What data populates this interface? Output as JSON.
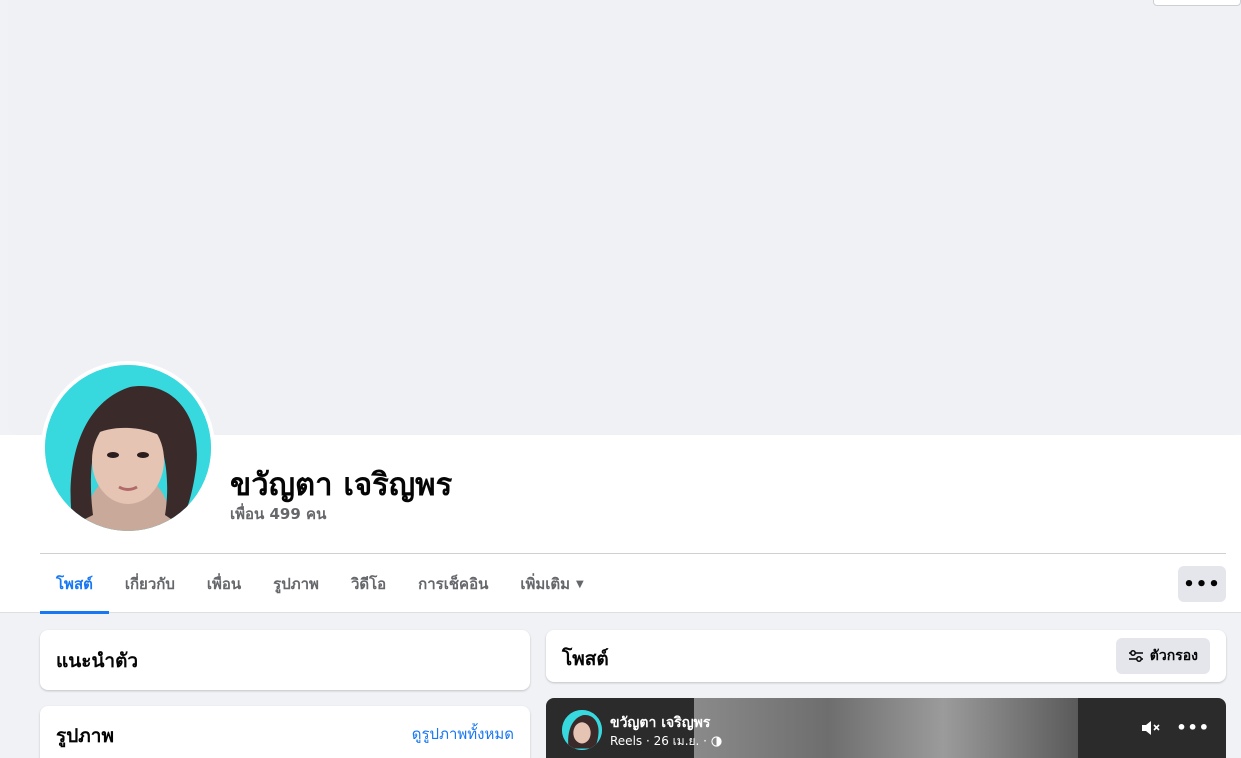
{
  "profile": {
    "name": "ขวัญตา เจริญพร",
    "friends_count": "เพื่อน 499 คน"
  },
  "tabs": [
    {
      "label": "โพสต์",
      "active": true
    },
    {
      "label": "เกี่ยวกับ",
      "active": false
    },
    {
      "label": "เพื่อน",
      "active": false
    },
    {
      "label": "รูปภาพ",
      "active": false
    },
    {
      "label": "วิดีโอ",
      "active": false
    },
    {
      "label": "การเช็คอิน",
      "active": false
    },
    {
      "label": "เพิ่มเติม",
      "active": false
    }
  ],
  "more_button": "•••",
  "intro": {
    "title": "แนะนำตัว"
  },
  "photos": {
    "title": "รูปภาพ",
    "see_all": "ดูรูปภาพทั้งหมด"
  },
  "posts": {
    "title": "โพสต์",
    "filter_label": "ตัวกรอง"
  },
  "reel_post": {
    "author": "ขวัญตา เจริญพร",
    "meta": "Reels · 26 เม.ย. ·",
    "menu": "•••"
  },
  "colors": {
    "accent": "#1877f2",
    "secondary_text": "#65676b",
    "button_bg": "#e4e6eb",
    "avatar_bg": "#38d8df"
  }
}
